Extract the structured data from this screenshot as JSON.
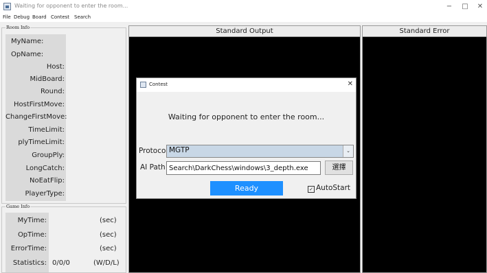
{
  "window": {
    "title": "Waiting for opponent to enter the room...",
    "minimize": "−",
    "maximize": "□",
    "close": "✕"
  },
  "menu": [
    "File",
    "Debug",
    "Board",
    "Contest",
    "Search"
  ],
  "room_info": {
    "legend": "Room Info",
    "fields": [
      "MyName:",
      "OpName:",
      "Host:",
      "MidBoard:",
      "Round:",
      "HostFirstMove:",
      "ChangeFirstMove:",
      "TimeLimit:",
      "plyTimeLimit:",
      "GroupPly:",
      "LongCatch:",
      "NoEatFlip:",
      "PlayerType:"
    ]
  },
  "game_info": {
    "legend": "Game Info",
    "labels": [
      "MyTime:",
      "OpTime:",
      "ErrorTime:",
      "Statistics:"
    ],
    "values": [
      "",
      "",
      "",
      "0/0/0"
    ],
    "units": [
      "(sec)",
      "(sec)",
      "(sec)",
      "(W/D/L)"
    ]
  },
  "panels": {
    "stdout": "Standard Output",
    "stderr": "Standard Error"
  },
  "dialog": {
    "title": "Contest",
    "close": "✕",
    "message": "Waiting for opponent to enter the room...",
    "protocol_label": "Protocol",
    "protocol_value": "MGTP",
    "ai_path_label": "AI Path",
    "ai_path_value": "Search\\DarkChess\\windows\\3_depth.exe",
    "browse_label": "選擇",
    "ready_label": "Ready",
    "autostart_label": "AutoStart",
    "autostart_checked": true
  },
  "colors": {
    "accent": "#1e90ff",
    "console_bg": "#000000",
    "label_bg": "#dadada",
    "select_highlight": "#c8d7e6"
  }
}
